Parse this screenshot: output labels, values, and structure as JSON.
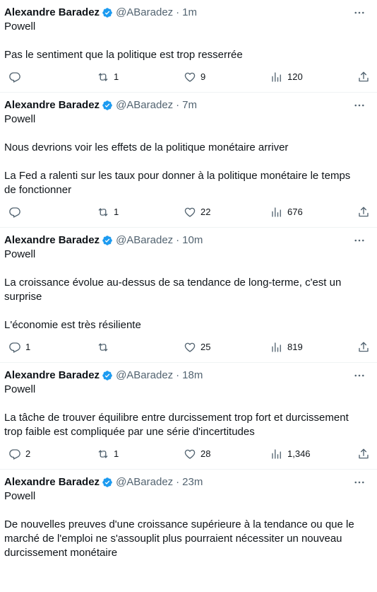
{
  "tweets": [
    {
      "name": "Alexandre Baradez",
      "handle": "@ABaradez",
      "sep": "·",
      "time": "1m",
      "paragraphs": [
        "Powell",
        "Pas le sentiment que la politique est trop resserrée"
      ],
      "replies": "",
      "retweets": "1",
      "likes": "9",
      "views": "120"
    },
    {
      "name": "Alexandre Baradez",
      "handle": "@ABaradez",
      "sep": "·",
      "time": "7m",
      "paragraphs": [
        "Powell",
        "Nous devrions voir les effets de la politique monétaire arriver",
        "La Fed a ralenti sur les taux pour donner à la politique monétaire le temps de fonctionner"
      ],
      "replies": "",
      "retweets": "1",
      "likes": "22",
      "views": "676"
    },
    {
      "name": "Alexandre Baradez",
      "handle": "@ABaradez",
      "sep": "·",
      "time": "10m",
      "paragraphs": [
        "Powell",
        "La croissance évolue au-dessus de sa tendance de long-terme, c'est un surprise",
        "L'économie est très résiliente"
      ],
      "replies": "1",
      "retweets": "",
      "likes": "25",
      "views": "819"
    },
    {
      "name": "Alexandre Baradez",
      "handle": "@ABaradez",
      "sep": "·",
      "time": "18m",
      "paragraphs": [
        "Powell",
        "La tâche de trouver équilibre entre durcissement trop fort et durcissement trop faible est compliquée par une série d'incertitudes"
      ],
      "replies": "2",
      "retweets": "1",
      "likes": "28",
      "views": "1,346"
    },
    {
      "name": "Alexandre Baradez",
      "handle": "@ABaradez",
      "sep": "·",
      "time": "23m",
      "paragraphs": [
        "Powell",
        "De nouvelles preuves d'une croissance supérieure à la tendance ou que le marché de l'emploi ne s'assouplit plus pourraient nécessiter un nouveau durcissement monétaire"
      ],
      "replies": "",
      "retweets": "",
      "likes": "",
      "views": ""
    }
  ],
  "colors": {
    "text": "#0f1419",
    "muted": "#536471",
    "verified": "#1d9bf0",
    "divider": "#eff3f4"
  },
  "icons": [
    "verified-badge-icon",
    "more-icon",
    "reply-icon",
    "retweet-icon",
    "like-icon",
    "views-icon",
    "share-icon"
  ]
}
